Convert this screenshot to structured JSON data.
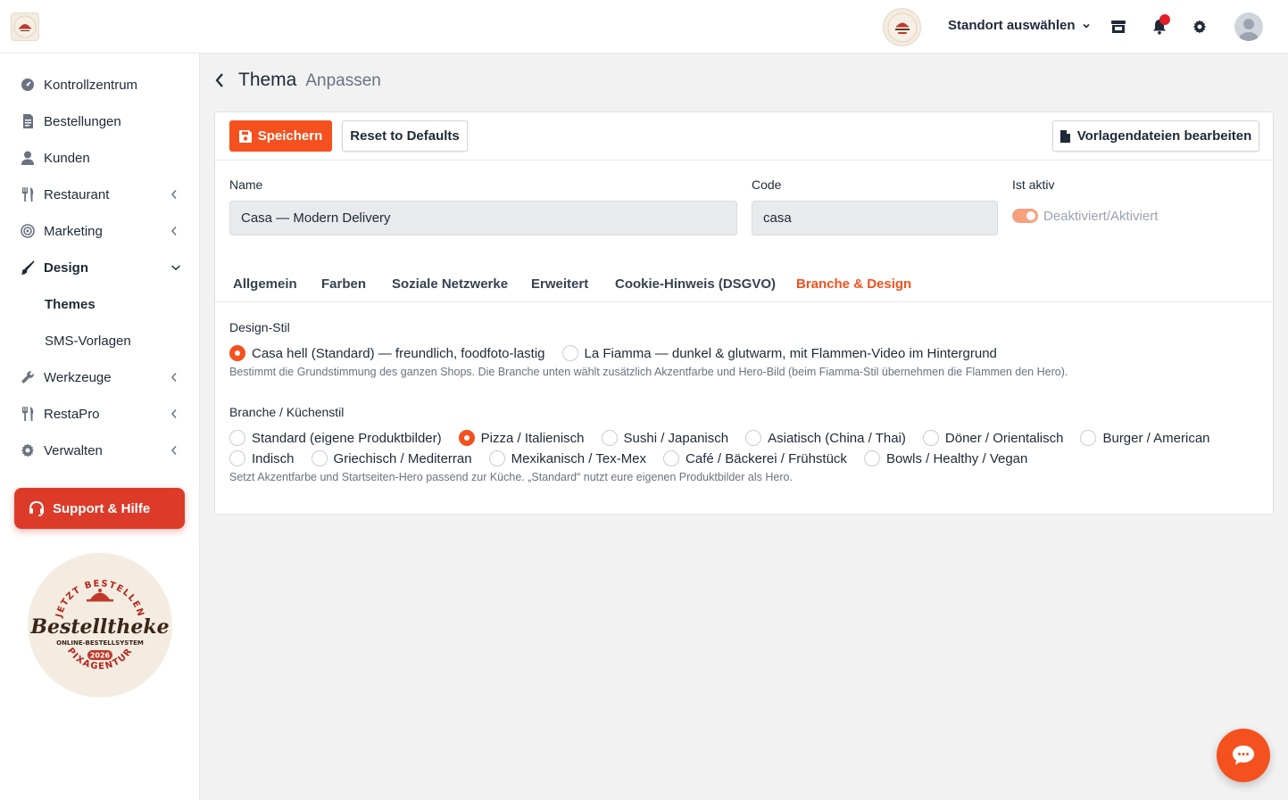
{
  "topbar": {
    "location_select_label": "Standort auswählen",
    "icons": [
      "store-icon",
      "bell-icon",
      "gear-icon",
      "user-avatar-icon"
    ]
  },
  "sidebar": {
    "items": [
      {
        "label": "Kontrollzentrum",
        "icon": "dashboard-icon"
      },
      {
        "label": "Bestellungen",
        "icon": "receipt-icon"
      },
      {
        "label": "Kunden",
        "icon": "user-icon"
      },
      {
        "label": "Restaurant",
        "icon": "utensils-icon"
      },
      {
        "label": "Marketing",
        "icon": "target-icon"
      },
      {
        "label": "Design",
        "icon": "brush-icon"
      },
      {
        "label": "Themes"
      },
      {
        "label": "SMS-Vorlagen"
      },
      {
        "label": "Werkzeuge",
        "icon": "wrench-icon"
      },
      {
        "label": "RestaPro",
        "icon": "utensils-icon"
      },
      {
        "label": "Verwalten",
        "icon": "gear-icon"
      }
    ],
    "support_label": "Support & Hilfe",
    "seal": {
      "top_text": "JETZT BESTELLEN",
      "brand": "Bestelltheke",
      "subtitle": "ONLINE-BESTELLSYSTEM",
      "year": "2026",
      "bottom_text": "PIXAGENTUR"
    }
  },
  "header": {
    "title": "Thema",
    "subtitle": "Anpassen"
  },
  "toolbar": {
    "save_label": "Speichern",
    "reset_label": "Reset to Defaults",
    "template_label": "Vorlagendateien bearbeiten"
  },
  "form": {
    "name_label": "Name",
    "name_value": "Casa — Modern Delivery",
    "code_label": "Code",
    "code_value": "casa",
    "active_label": "Ist aktiv",
    "active_toggle_label": "Deaktiviert/Aktiviert",
    "active": true
  },
  "tabs": [
    {
      "label": "Allgemein"
    },
    {
      "label": "Farben"
    },
    {
      "label": "Soziale Netzwerke"
    },
    {
      "label": "Erweitert"
    },
    {
      "label": "Cookie-Hinweis (DSGVO)"
    },
    {
      "label": "Branche & Design",
      "active": true
    }
  ],
  "design_style": {
    "label": "Design-Stil",
    "options": [
      {
        "label": "Casa hell (Standard) — freundlich, foodfoto-lastig",
        "checked": true
      },
      {
        "label": "La Fiamma — dunkel & glutwarm, mit Flammen-Video im Hintergrund",
        "checked": false
      }
    ],
    "help": "Bestimmt die Grundstimmung des ganzen Shops. Die Branche unten wählt zusätzlich Akzentfarbe und Hero-Bild (beim Fiamma-Stil übernehmen die Flammen den Hero)."
  },
  "cuisine": {
    "label": "Branche / Küchenstil",
    "row1": [
      {
        "label": "Standard (eigene Produktbilder)",
        "checked": false
      },
      {
        "label": "Pizza / Italienisch",
        "checked": true
      },
      {
        "label": "Sushi / Japanisch",
        "checked": false
      },
      {
        "label": "Asiatisch (China / Thai)",
        "checked": false
      },
      {
        "label": "Döner / Orientalisch",
        "checked": false
      },
      {
        "label": "Burger / American",
        "checked": false
      }
    ],
    "row2": [
      {
        "label": "Indisch",
        "checked": false
      },
      {
        "label": "Griechisch / Mediterran",
        "checked": false
      },
      {
        "label": "Mexikanisch / Tex-Mex",
        "checked": false
      },
      {
        "label": "Café / Bäckerei / Frühstück",
        "checked": false
      },
      {
        "label": "Bowls / Healthy / Vegan",
        "checked": false
      }
    ],
    "help": "Setzt Akzentfarbe und Startseiten-Hero passend zur Küche. „Standard“ nutzt eure eigenen Produktbilder als Hero."
  },
  "colors": {
    "accent": "#f4511e",
    "support": "#dc3b2a",
    "notification": "#e11d2a"
  }
}
